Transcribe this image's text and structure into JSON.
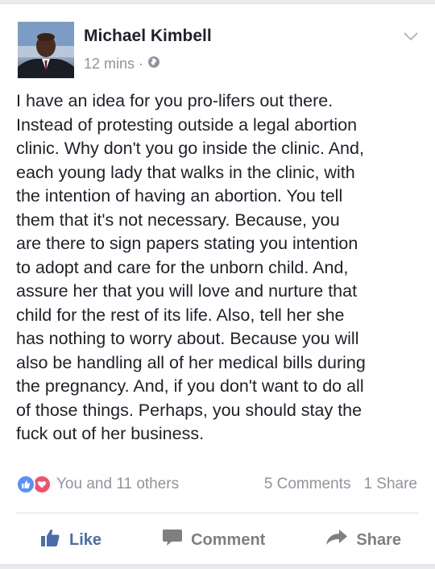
{
  "post": {
    "author": "Michael Kimbell",
    "time": "12 mins",
    "separator": "·",
    "privacy_icon": "globe-icon",
    "body": "I have an idea for you pro-lifers out there.\nInstead of protesting outside a legal abortion\nclinic. Why don't you go inside the clinic. And,\neach young lady that walks in the clinic, with\nthe intention of having an abortion. You tell\nthem that it's not necessary. Because, you\nare there to sign papers stating you intention\nto adopt and care for the unborn child. And,\nassure her that you will love and nurture that\nchild for the rest of its life. Also, tell her she\nhas nothing to worry about. Because  you will\nalso be handling all of her medical bills during\nthe pregnancy. And, if you don't want to do all\nof those things. Perhaps, you should stay the\nfuck out of her business."
  },
  "reactions": {
    "icons": [
      "like-reaction-icon",
      "love-reaction-icon"
    ],
    "summary": "You and 11 others",
    "comments": "5 Comments",
    "shares": "1 Share"
  },
  "actions": {
    "like": "Like",
    "comment": "Comment",
    "share": "Share"
  },
  "colors": {
    "like_blue": "#4b6ea9",
    "like_reaction": "#5890ff",
    "love_reaction": "#f25268",
    "meta_gray": "#90949c",
    "text": "#1d2129"
  }
}
